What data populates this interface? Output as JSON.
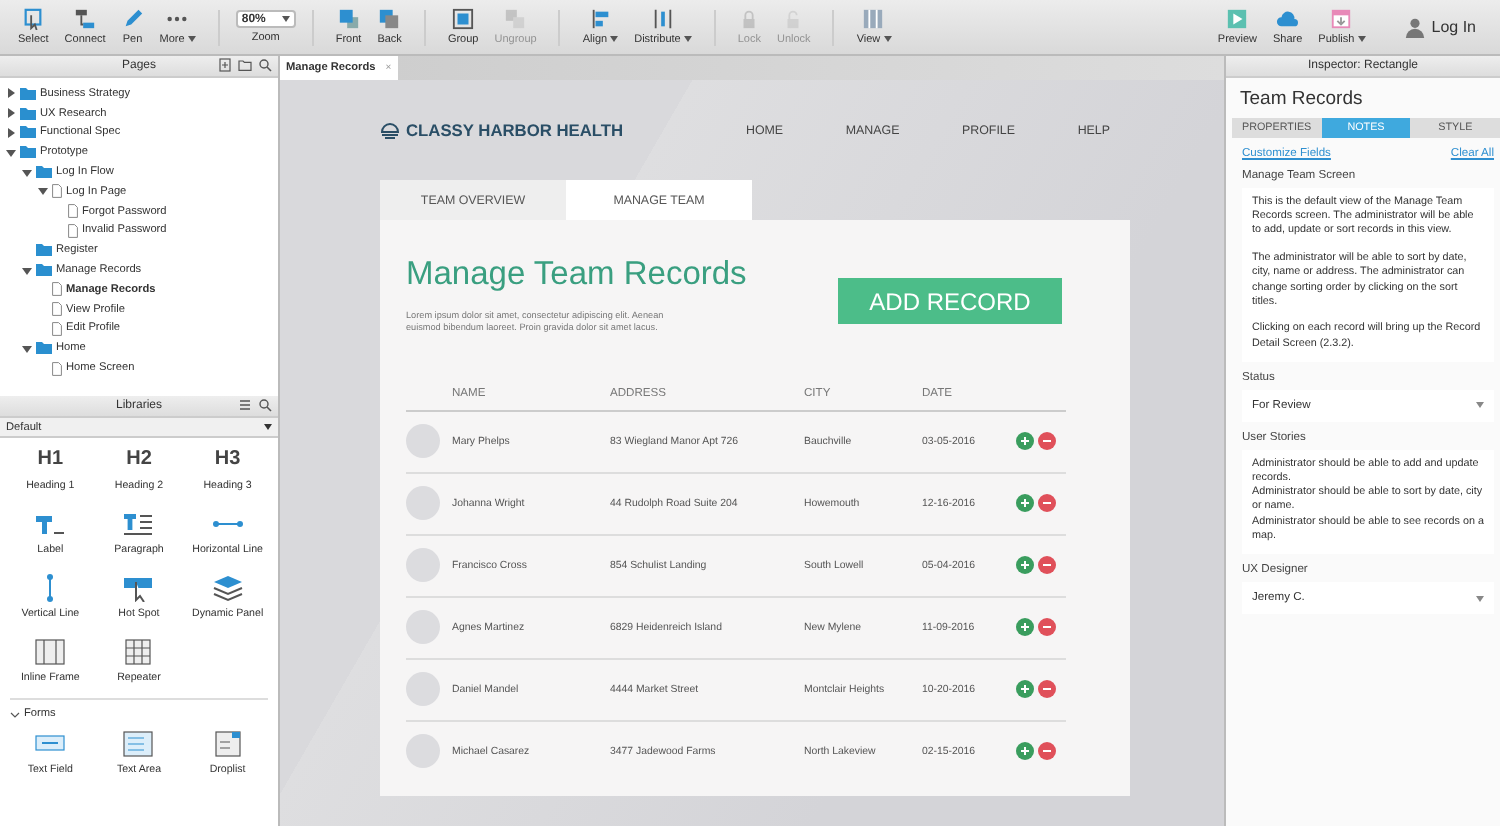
{
  "toolbar": {
    "tools_left": [
      {
        "kind": "select",
        "label": "Select",
        "disabled": false,
        "dropdown": false
      },
      {
        "kind": "connect",
        "label": "Connect",
        "disabled": false,
        "dropdown": false
      },
      {
        "kind": "pen",
        "label": "Pen",
        "disabled": false,
        "dropdown": false
      },
      {
        "kind": "more",
        "label": "More",
        "disabled": false,
        "dropdown": true
      }
    ],
    "zoom": {
      "value": "80%",
      "label": "Zoom"
    },
    "tools": [
      {
        "kind": "front",
        "label": "Front",
        "disabled": false,
        "dropdown": false
      },
      {
        "kind": "back",
        "label": "Back",
        "disabled": false,
        "dropdown": false
      },
      {
        "kind": "group",
        "label": "Group",
        "disabled": false,
        "dropdown": false
      },
      {
        "kind": "ungroup",
        "label": "Ungroup",
        "disabled": true,
        "dropdown": false
      },
      {
        "kind": "align",
        "label": "Align",
        "disabled": false,
        "dropdown": true
      },
      {
        "kind": "distribute",
        "label": "Distribute",
        "disabled": false,
        "dropdown": true
      },
      {
        "kind": "lock",
        "label": "Lock",
        "disabled": true,
        "dropdown": false
      },
      {
        "kind": "unlock",
        "label": "Unlock",
        "disabled": true,
        "dropdown": false
      },
      {
        "kind": "view",
        "label": "View",
        "disabled": false,
        "dropdown": true
      }
    ],
    "tools_right": [
      {
        "kind": "preview",
        "label": "Preview",
        "disabled": false,
        "dropdown": false
      },
      {
        "kind": "share",
        "label": "Share",
        "disabled": false,
        "dropdown": false
      },
      {
        "kind": "publish",
        "label": "Publish",
        "disabled": false,
        "dropdown": true
      }
    ],
    "login": "Log In"
  },
  "pages": {
    "title": "Pages",
    "tree": [
      {
        "label": "Business Strategy",
        "kind": "folder",
        "expanded": false,
        "selected": false
      },
      {
        "label": "UX Research",
        "kind": "folder",
        "expanded": false,
        "selected": false
      },
      {
        "label": "Functional Spec",
        "kind": "folder",
        "expanded": false,
        "selected": false
      },
      {
        "label": "Prototype",
        "kind": "folder",
        "expanded": true,
        "selected": false,
        "children": [
          {
            "label": "Log In Flow",
            "kind": "folder",
            "expanded": true,
            "selected": false,
            "children": [
              {
                "label": "Log In Page",
                "kind": "page",
                "expanded": true,
                "selected": false,
                "children": [
                  {
                    "label": "Forgot Password",
                    "kind": "page",
                    "selected": false
                  },
                  {
                    "label": "Invalid Password",
                    "kind": "page",
                    "selected": false
                  }
                ]
              }
            ]
          },
          {
            "label": "Register",
            "kind": "folder",
            "selected": false
          },
          {
            "label": "Manage Records",
            "kind": "folder",
            "expanded": true,
            "selected": false,
            "children": [
              {
                "label": "Manage Records",
                "kind": "page",
                "selected": true
              },
              {
                "label": "View Profile",
                "kind": "page",
                "selected": false
              },
              {
                "label": "Edit Profile",
                "kind": "page",
                "selected": false
              }
            ]
          },
          {
            "label": "Home",
            "kind": "folder",
            "expanded": true,
            "selected": false,
            "children": [
              {
                "label": "Home Screen",
                "kind": "page",
                "selected": false
              }
            ]
          }
        ]
      }
    ]
  },
  "libraries": {
    "title": "Libraries",
    "library": "Default",
    "items": [
      {
        "kind": "heading",
        "glyph": "H1",
        "label": "Heading 1"
      },
      {
        "kind": "heading",
        "glyph": "H2",
        "label": "Heading 2"
      },
      {
        "kind": "heading",
        "glyph": "H3",
        "label": "Heading 3"
      },
      {
        "kind": "label",
        "label": "Label"
      },
      {
        "kind": "paragraph",
        "label": "Paragraph"
      },
      {
        "kind": "hline",
        "label": "Horizontal Line"
      },
      {
        "kind": "vline",
        "label": "Vertical Line"
      },
      {
        "kind": "hotspot",
        "label": "Hot Spot"
      },
      {
        "kind": "panel",
        "label": "Dynamic Panel"
      },
      {
        "kind": "iframe",
        "label": "Inline Frame"
      },
      {
        "kind": "repeater",
        "label": "Repeater"
      }
    ],
    "section": {
      "label": "Forms",
      "expanded": true
    },
    "form_items": [
      {
        "kind": "textfield",
        "label": "Text Field"
      },
      {
        "kind": "textarea",
        "label": "Text Area"
      },
      {
        "kind": "droplist",
        "label": "Droplist"
      }
    ]
  },
  "document_tab": {
    "label": "Manage Records",
    "close": "×"
  },
  "mockup": {
    "brand": "CLASSY HARBOR HEALTH",
    "nav": [
      "HOME",
      "MANAGE",
      "PROFILE",
      "HELP"
    ],
    "tabs": [
      {
        "label": "TEAM OVERVIEW",
        "selected": false
      },
      {
        "label": "MANAGE TEAM",
        "selected": true
      }
    ],
    "heading": "Manage Team Records",
    "intro": "Lorem ipsum dolor sit amet, consectetur adipiscing elit. Aenean euismod bibendum laoreet. Proin gravida dolor sit amet lacus.",
    "add_button": "ADD RECORD",
    "table": {
      "columns": [
        "NAME",
        "ADDRESS",
        "CITY",
        "DATE"
      ],
      "rows": [
        {
          "name": "Mary Phelps",
          "address": "83 Wiegland Manor Apt 726",
          "city": "Bauchville",
          "date": "03-05-2016"
        },
        {
          "name": "Johanna Wright",
          "address": "44 Rudolph Road Suite 204",
          "city": "Howemouth",
          "date": "12-16-2016"
        },
        {
          "name": "Francisco Cross",
          "address": "854 Schulist Landing",
          "city": "South Lowell",
          "date": "05-04-2016"
        },
        {
          "name": "Agnes Martinez",
          "address": "6829 Heidenreich Island",
          "city": "New Mylene",
          "date": "11-09-2016"
        },
        {
          "name": "Daniel Mandel",
          "address": "4444 Market Street",
          "city": "Montclair Heights",
          "date": "10-20-2016"
        },
        {
          "name": "Michael Casarez",
          "address": "3477 Jadewood Farms",
          "city": "North Lakeview",
          "date": "02-15-2016"
        }
      ]
    }
  },
  "inspector": {
    "title": "Inspector: Rectangle",
    "name": "Team Records",
    "tabs": [
      {
        "label": "PROPERTIES",
        "selected": false
      },
      {
        "label": "NOTES",
        "selected": true
      },
      {
        "label": "STYLE",
        "selected": false
      }
    ],
    "links": [
      "Customize Fields",
      "Clear All"
    ],
    "fields": [
      {
        "kind": "text",
        "label": "Manage Team Screen",
        "paragraphs": [
          "This is the default view of the Manage Team Records screen. The administrator will be able to add, update or sort records in this view.",
          "The administrator will be able to sort by date, city, name or address. The administrator can change sorting order by clicking on the sort titles.",
          "Clicking on each record will bring up the Record Detail Screen (2.3.2)."
        ]
      },
      {
        "kind": "select",
        "label": "Status",
        "value": "For Review"
      },
      {
        "kind": "lines",
        "label": "User Stories",
        "paragraphs": [
          "Administrator should be able to add and update records.",
          "Administrator should be able to sort by date, city or name.",
          "Administrator should be able to see records on a map."
        ]
      },
      {
        "kind": "select",
        "label": "UX Designer",
        "value": "Jeremy C."
      }
    ]
  }
}
